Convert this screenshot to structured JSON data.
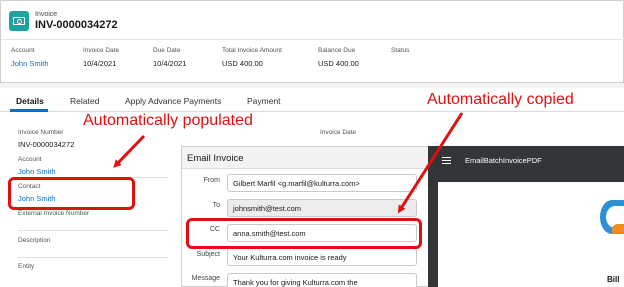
{
  "header": {
    "object_type": "Invoice",
    "record_name": "INV-0000034272",
    "icon": "invoice-icon",
    "fields": [
      {
        "label": "Account",
        "value": "John Smith"
      },
      {
        "label": "Invoice Date",
        "value": "10/4/2021"
      },
      {
        "label": "Due Date",
        "value": "10/4/2021"
      },
      {
        "label": "Total Invoice Amount",
        "value": "USD 400.00"
      },
      {
        "label": "Balance Due",
        "value": "USD 400.00"
      },
      {
        "label": "Status",
        "value": ""
      }
    ]
  },
  "tabs": [
    "Details",
    "Related",
    "Apply Advance Payments",
    "Payment"
  ],
  "details": {
    "invoice_number_label": "Invoice Number",
    "invoice_number_value": "INV-0000034272",
    "invoice_date_label": "Invoice Date",
    "account_label": "Account",
    "account_value": "John Smith",
    "contact_label": "Contact",
    "contact_value": "John Smith",
    "external_invoice_number_label": "External Invoice Number",
    "description_label": "Description",
    "entity_label": "Entity"
  },
  "email_modal": {
    "title": "Email Invoice",
    "from_label": "From",
    "from_value": "Gilbert Marfil <g.marfil@kulturra.com>",
    "to_label": "To",
    "to_value": "johnsmith@test.com",
    "cc_label": "CC",
    "cc_value": "anna.smith@test.com",
    "subject_label": "Subject",
    "subject_value": "Your Kulturra.com invoice is ready",
    "message_label": "Message",
    "message_value": "Thank you for giving Kulturra.com the"
  },
  "pdf_viewer": {
    "title": "EmailBatchInvoicePDF",
    "bill_text": "Bill"
  },
  "annotations": {
    "populated": "Automatically populated",
    "copied": "Automatically copied",
    "color": "#e01010"
  },
  "colors": {
    "link": "#0b6fc6",
    "accent": "#1fa3a0",
    "pdf_bg": "#323639"
  }
}
